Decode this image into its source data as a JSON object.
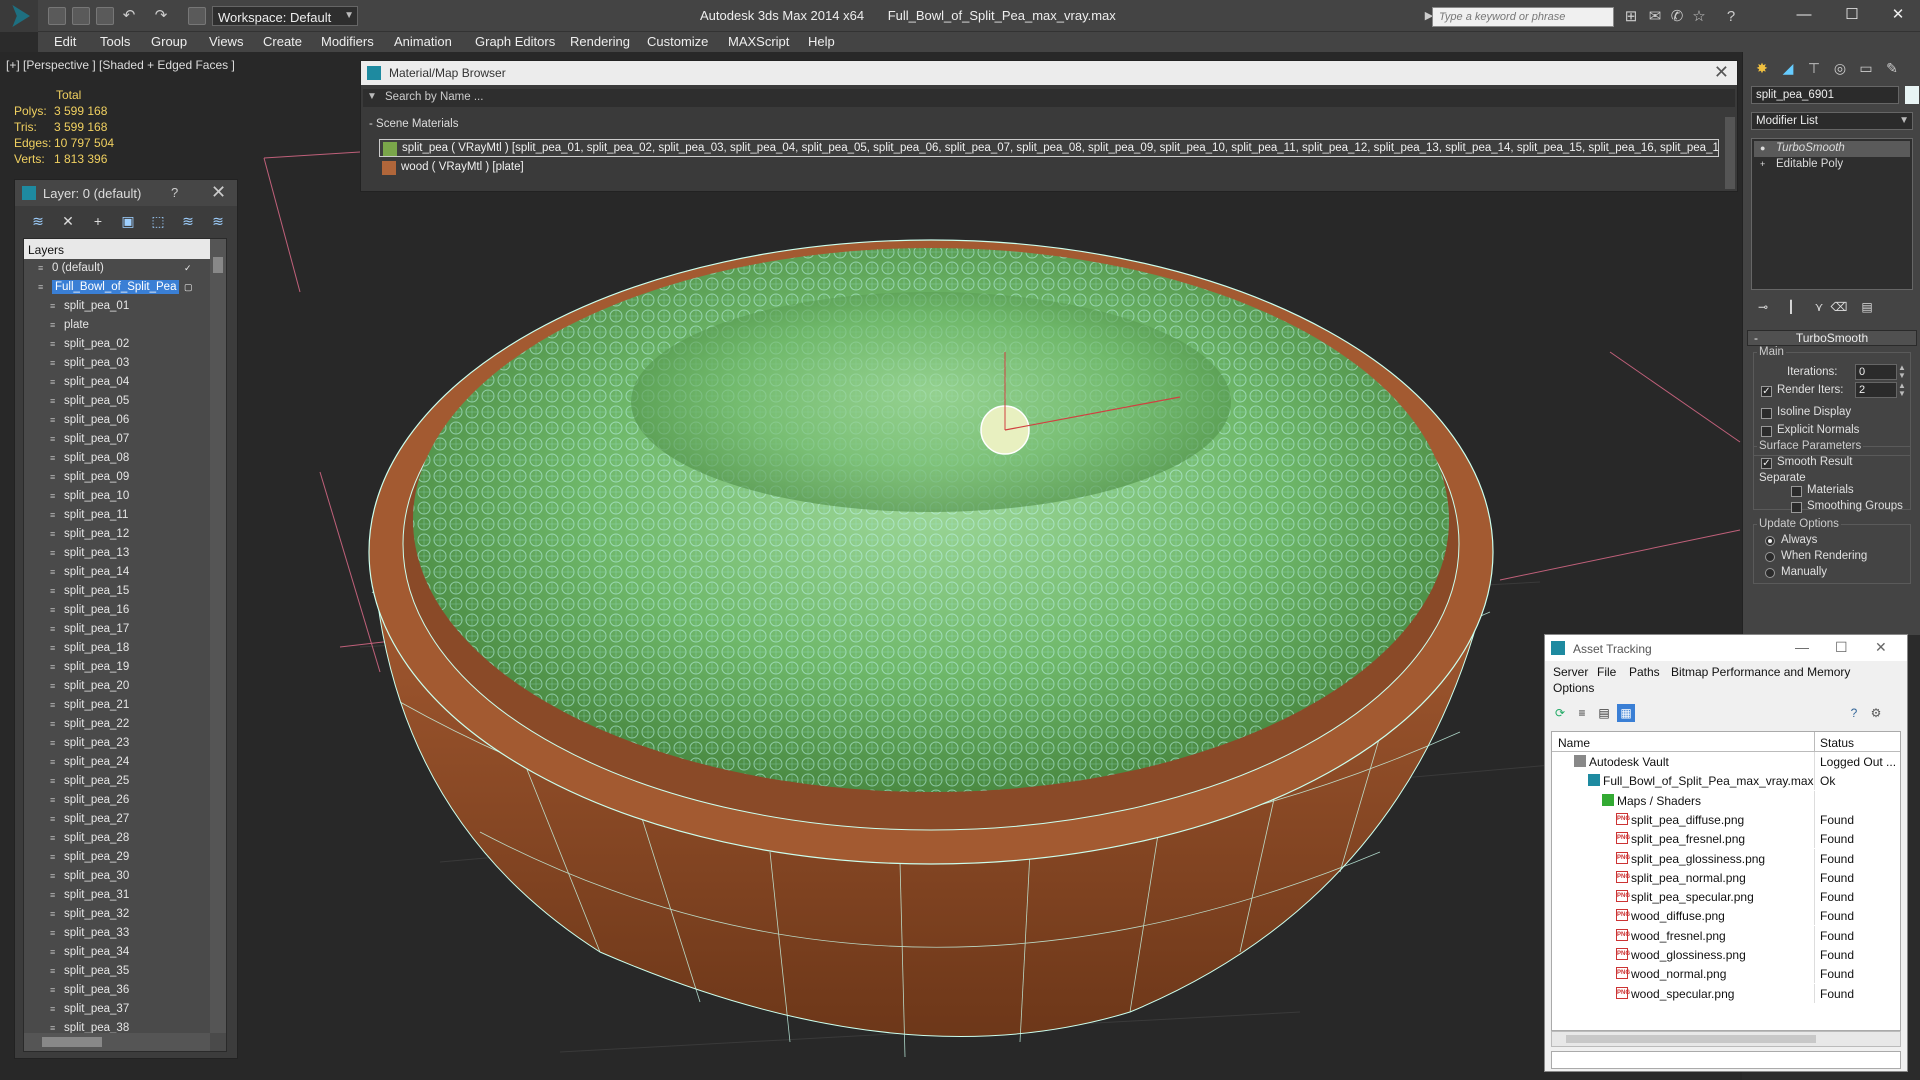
{
  "app": {
    "title": "Autodesk 3ds Max  2014 x64",
    "file": "Full_Bowl_of_Split_Pea_max_vray.max",
    "workspace": "Workspace: Default",
    "search_placeholder": "Type a keyword or phrase"
  },
  "menu": [
    "Edit",
    "Tools",
    "Group",
    "Views",
    "Create",
    "Modifiers",
    "Animation",
    "Graph Editors",
    "Rendering",
    "Customize",
    "MAXScript",
    "Help"
  ],
  "viewport": {
    "label": "[+] [Perspective ] [Shaded + Edged Faces ]",
    "stats": {
      "total_label": "Total",
      "rows": [
        {
          "label": "Polys:",
          "value": "3 599 168"
        },
        {
          "label": "Tris:",
          "value": "3 599 168"
        },
        {
          "label": "Edges:",
          "value": "10 797 504"
        },
        {
          "label": "Verts:",
          "value": "1 813 396"
        }
      ]
    }
  },
  "layer_explorer": {
    "title": "Layer: 0 (default)",
    "help": "?",
    "column": "Layers",
    "default_layer": "0 (default)",
    "selected_layer": "Full_Bowl_of_Split_Pea",
    "objects": [
      "split_pea_01",
      "plate",
      "split_pea_02",
      "split_pea_03",
      "split_pea_04",
      "split_pea_05",
      "split_pea_06",
      "split_pea_07",
      "split_pea_08",
      "split_pea_09",
      "split_pea_10",
      "split_pea_11",
      "split_pea_12",
      "split_pea_13",
      "split_pea_14",
      "split_pea_15",
      "split_pea_16",
      "split_pea_17",
      "split_pea_18",
      "split_pea_19",
      "split_pea_20",
      "split_pea_21",
      "split_pea_22",
      "split_pea_23",
      "split_pea_24",
      "split_pea_25",
      "split_pea_26",
      "split_pea_27",
      "split_pea_28",
      "split_pea_29",
      "split_pea_30",
      "split_pea_31",
      "split_pea_32",
      "split_pea_33",
      "split_pea_34",
      "split_pea_35",
      "split_pea_36",
      "split_pea_37",
      "split_pea_38"
    ]
  },
  "material_browser": {
    "title": "Material/Map Browser",
    "search": "Search by Name ...",
    "section": "- Scene Materials",
    "materials": [
      {
        "label": "split_pea ( VRayMtl ) [split_pea_01, split_pea_02, split_pea_03, split_pea_04, split_pea_05, split_pea_06, split_pea_07, split_pea_08, split_pea_09, split_pea_10, split_pea_11, split_pea_12, split_pea_13, split_pea_14, split_pea_15, split_pea_16, split_pea_1...",
        "color": "#7aa64a"
      },
      {
        "label": "wood  ( VRayMtl )  [plate]",
        "color": "#b0663a"
      }
    ]
  },
  "command_panel": {
    "object_name": "split_pea_6901",
    "modifier_list": "Modifier List",
    "stack": [
      "TurboSmooth",
      "Editable Poly"
    ],
    "rollout_title": "TurboSmooth",
    "main_group": "Main",
    "iterations_label": "Iterations:",
    "iterations_value": "0",
    "render_iters_label": "Render Iters:",
    "render_iters_value": "2",
    "render_iters_checked": true,
    "isoline_label": "Isoline Display",
    "explicit_normals_label": "Explicit Normals",
    "surface_group": "Surface Parameters",
    "smooth_result_label": "Smooth Result",
    "separate_label": "Separate",
    "materials_label": "Materials",
    "smoothing_groups_label": "Smoothing Groups",
    "update_group": "Update Options",
    "update_options": [
      "Always",
      "When Rendering",
      "Manually"
    ]
  },
  "asset_tracking": {
    "title": "Asset Tracking",
    "menu": [
      "Server",
      "File",
      "Paths",
      "Bitmap Performance and Memory",
      "Options"
    ],
    "col_name": "Name",
    "col_status": "Status",
    "rows": [
      {
        "name": "Autodesk Vault",
        "status": "Logged Out ...",
        "level": 1,
        "icon": "vault-icon"
      },
      {
        "name": "Full_Bowl_of_Split_Pea_max_vray.max",
        "status": "Ok",
        "level": 2,
        "icon": "max-file-icon"
      },
      {
        "name": "Maps / Shaders",
        "status": "",
        "level": 3,
        "icon": "maps-icon"
      },
      {
        "name": "split_pea_diffuse.png",
        "status": "Found",
        "level": 4,
        "icon": "png-icon"
      },
      {
        "name": "split_pea_fresnel.png",
        "status": "Found",
        "level": 4,
        "icon": "png-icon"
      },
      {
        "name": "split_pea_glossiness.png",
        "status": "Found",
        "level": 4,
        "icon": "png-icon"
      },
      {
        "name": "split_pea_normal.png",
        "status": "Found",
        "level": 4,
        "icon": "png-icon"
      },
      {
        "name": "split_pea_specular.png",
        "status": "Found",
        "level": 4,
        "icon": "png-icon"
      },
      {
        "name": "wood_diffuse.png",
        "status": "Found",
        "level": 4,
        "icon": "png-icon"
      },
      {
        "name": "wood_fresnel.png",
        "status": "Found",
        "level": 4,
        "icon": "png-icon"
      },
      {
        "name": "wood_glossiness.png",
        "status": "Found",
        "level": 4,
        "icon": "png-icon"
      },
      {
        "name": "wood_normal.png",
        "status": "Found",
        "level": 4,
        "icon": "png-icon"
      },
      {
        "name": "wood_specular.png",
        "status": "Found",
        "level": 4,
        "icon": "png-icon"
      }
    ]
  }
}
